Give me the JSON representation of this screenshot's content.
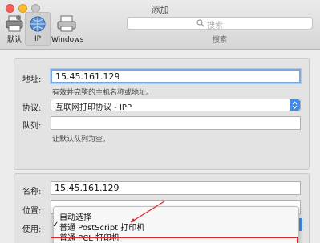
{
  "window": {
    "title": "添加"
  },
  "toolbar": {
    "items": [
      {
        "label": "默认",
        "icon": "printer-default-icon"
      },
      {
        "label": "IP",
        "icon": "globe-icon",
        "selected": true
      },
      {
        "label": "Windows",
        "icon": "printer-windows-icon"
      }
    ]
  },
  "search": {
    "placeholder": "搜索",
    "caption": "搜索"
  },
  "form": {
    "address_label": "地址:",
    "address_value": "15.45.161.129",
    "address_hint": "有效并完整的主机名称或地址。",
    "protocol_label": "协议:",
    "protocol_value": "互联网打印协议 - IPP",
    "queue_label": "队列:",
    "queue_value": "",
    "queue_hint": "让默认队列为空。",
    "name_label": "名称:",
    "name_value": "15.45.161.129",
    "location_label": "位置:",
    "use_label": "使用:"
  },
  "use_menu": {
    "items": [
      {
        "label": "自动选择",
        "checked": false
      },
      {
        "label": "普通 PostScript 打印机",
        "checked": true
      },
      {
        "label": "普通 PCL 打印机",
        "checked": false
      }
    ]
  },
  "colors": {
    "accent": "#3d8ae8",
    "highlight_box": "#d9272e",
    "arrow": "#d9272e"
  }
}
